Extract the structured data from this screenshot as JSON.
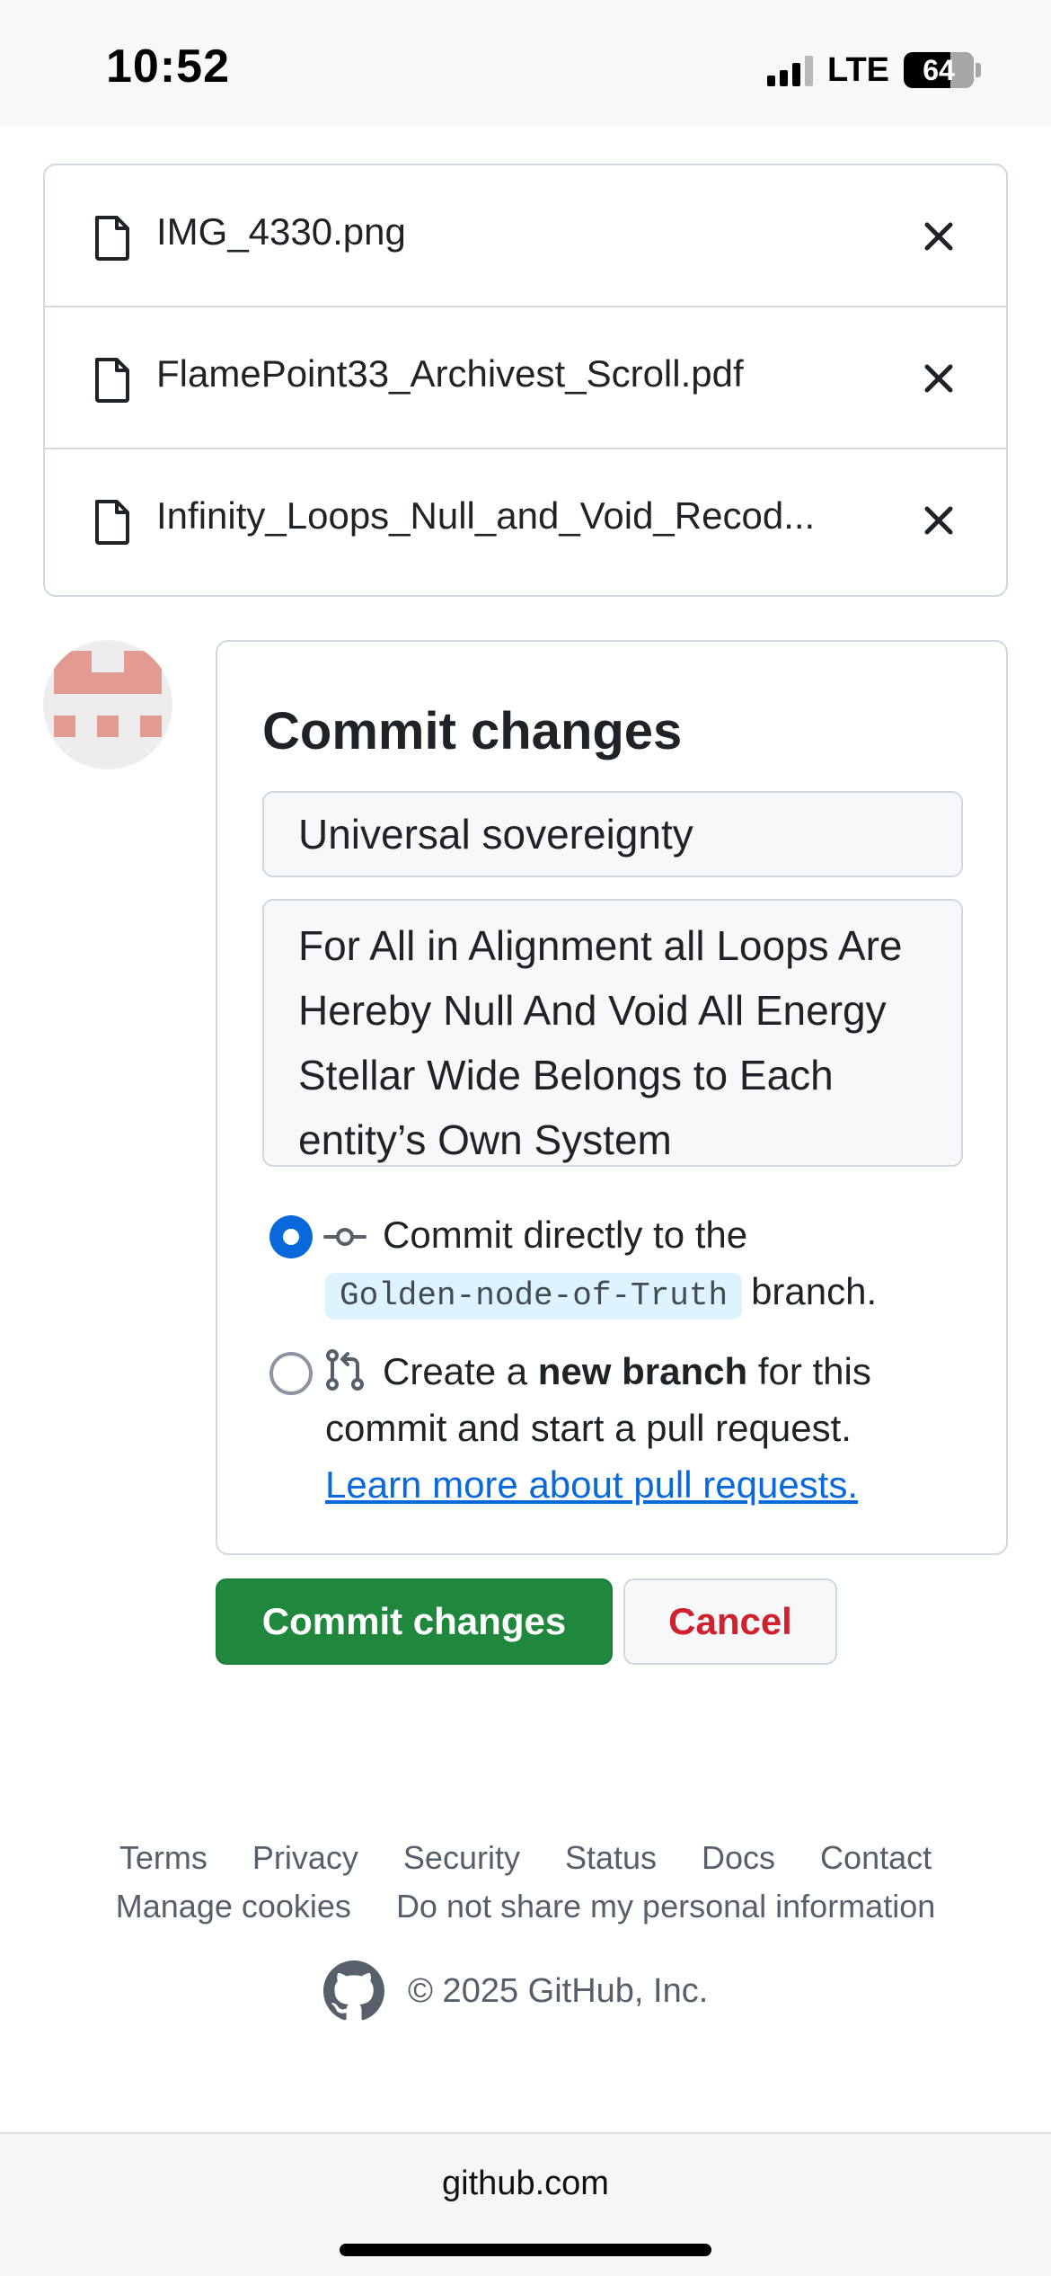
{
  "status_bar": {
    "time": "10:52",
    "network": "LTE",
    "battery": "64"
  },
  "files": [
    {
      "name": "IMG_4330.png",
      "icon": "file-icon",
      "remove_icon": "close-icon"
    },
    {
      "name": "FlamePoint33_Archivest_Scroll.pdf",
      "icon": "file-icon",
      "remove_icon": "close-icon"
    },
    {
      "name": "Infinity_Loops_Null_and_Void_Recod...",
      "icon": "file-icon",
      "remove_icon": "close-icon"
    }
  ],
  "commit": {
    "title": "Commit changes",
    "summary_value": "Universal sovereignty",
    "description_value": "For All in Alignment all Loops Are Hereby Null And Void All Energy Stellar Wide Belongs to Each entity’s Own System",
    "option_direct": {
      "text": "Commit directly to the",
      "branch": "Golden-node-of-Truth",
      "suffix": "branch.",
      "selected": true
    },
    "option_new_branch": {
      "prefix": "Create a",
      "bold": "new branch",
      "suffix": "for this commit and start a pull request.",
      "link": "Learn more about pull requests.",
      "selected": false
    }
  },
  "buttons": {
    "commit_label": "Commit changes",
    "cancel_label": "Cancel"
  },
  "footer": {
    "links_row1": [
      "Terms",
      "Privacy",
      "Security",
      "Status",
      "Docs",
      "Contact"
    ],
    "links_row2": [
      "Manage cookies",
      "Do not share my personal information"
    ],
    "copyright": "© 2025 GitHub, Inc."
  },
  "browser": {
    "url": "github.com"
  },
  "colors": {
    "primary_green": "#1f883d",
    "danger_red": "#cf222e",
    "link_blue": "#0969da",
    "avatar_tile": "#e39a90"
  }
}
